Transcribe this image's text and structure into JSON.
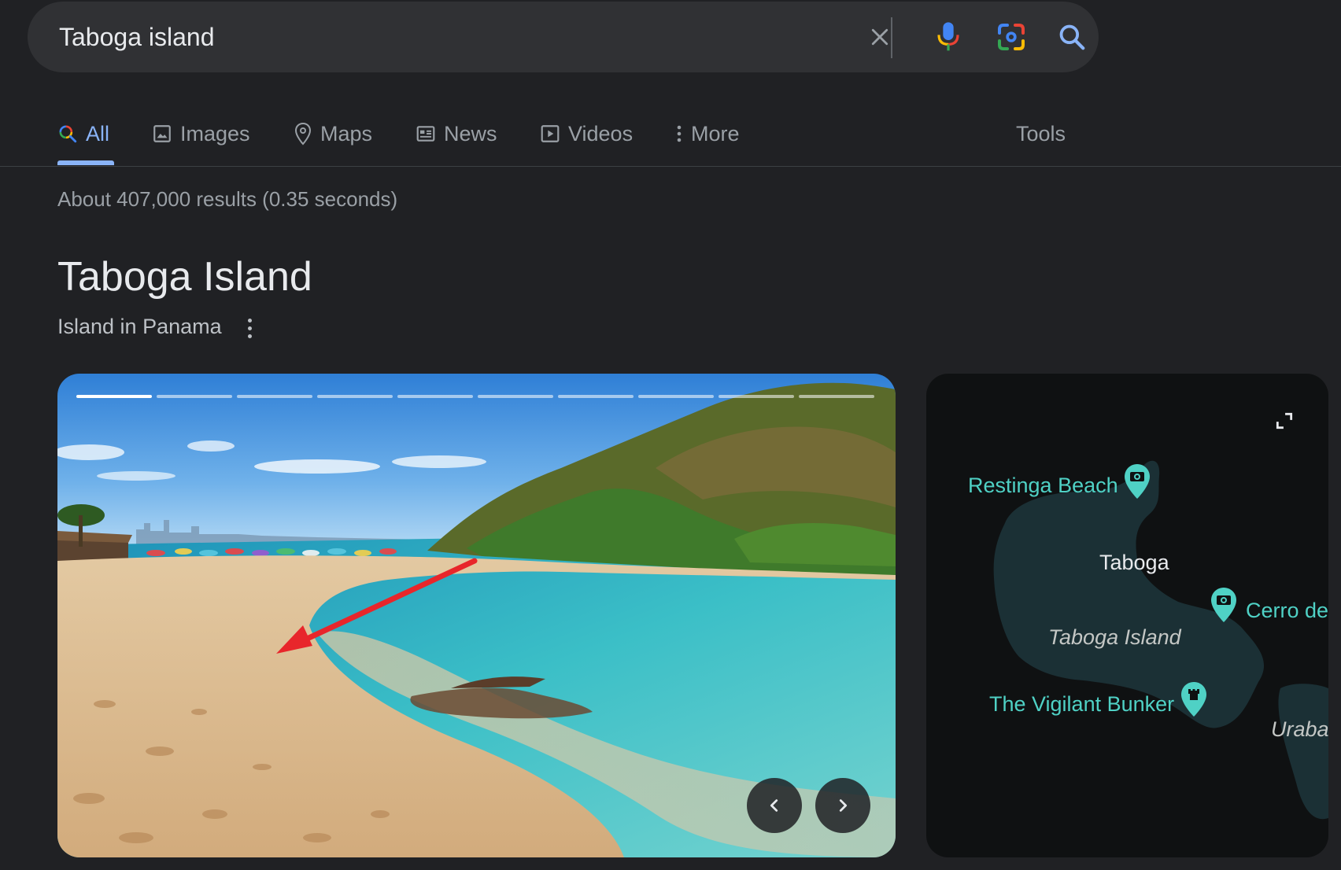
{
  "search": {
    "query": "Taboga island"
  },
  "icons": {
    "clear": "close-icon",
    "voice": "mic-icon",
    "lens": "camera-lens-icon",
    "submit": "search-icon",
    "tab_all": "search-icon",
    "tab_images": "image-icon",
    "tab_maps": "map-pin-icon",
    "tab_news": "newspaper-icon",
    "tab_videos": "play-icon",
    "tab_more": "vertical-dots-icon"
  },
  "colors": {
    "background": "#202124",
    "accent": "#8ab4f8",
    "poi": "#4fd1c5",
    "google_blue": "#4285f4",
    "google_red": "#ea4335",
    "google_yellow": "#fbbc05",
    "google_green": "#34a853"
  },
  "tabs": {
    "items": [
      {
        "label": "All",
        "active": true
      },
      {
        "label": "Images"
      },
      {
        "label": "Maps"
      },
      {
        "label": "News"
      },
      {
        "label": "Videos"
      },
      {
        "label": "More"
      }
    ],
    "tools_label": "Tools"
  },
  "results": {
    "stats": "About 407,000 results (0.35 seconds)"
  },
  "knowledge_panel": {
    "title": "Taboga Island",
    "subtitle": "Island in Panama",
    "carousel": {
      "total_images": 10,
      "current_image": 1
    },
    "map": {
      "labels": {
        "restinga": "Restinga Beach",
        "taboga": "Taboga",
        "cerro": "Cerro de",
        "taboga_island": "Taboga Island",
        "bunker": "The Vigilant Bunker",
        "uraba": "Uraba"
      }
    }
  }
}
